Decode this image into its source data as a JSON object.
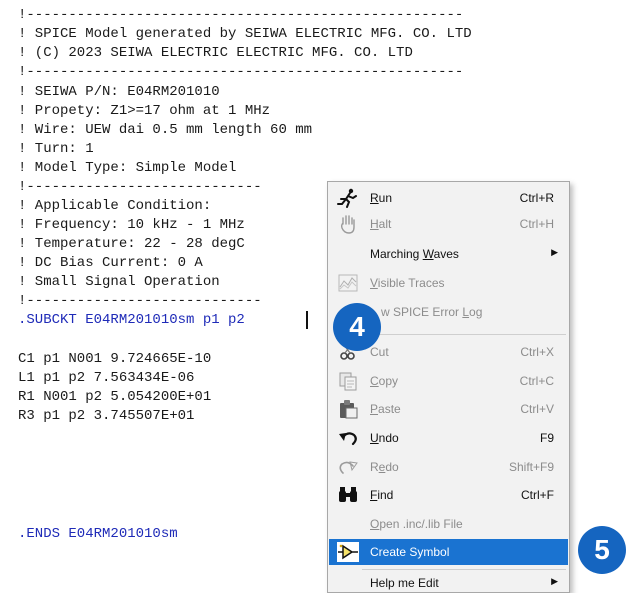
{
  "editor": {
    "lines": [
      "!----------------------------------------------------",
      "! SPICE Model generated by SEIWA ELECTRIC MFG. CO. LTD",
      "! (C) 2023 SEIWA ELECTRIC ELECTRIC MFG. CO. LTD",
      "!----------------------------------------------------",
      "! SEIWA P/N: E04RM201010",
      "! Propety: Z1>=17 ohm at 1 MHz",
      "! Wire: UEW dai 0.5 mm length 60 mm",
      "! Turn: 1",
      "! Model Type: Simple Model",
      "!----------------------------",
      "! Applicable Condition:",
      "! Frequency: 10 kHz - 1 MHz",
      "! Temperature: 22 - 28 degC",
      "! DC Bias Current: 0 A",
      "! Small Signal Operation",
      "!----------------------------",
      ".SUBCKT E04RM201010sm p1 p2",
      "",
      "C1 p1 N001 9.724665E-10",
      "L1 p1 p2 7.563434E-06",
      "R1 N001 p2 5.054200E+01",
      "R3 p1 p2 3.745507E+01",
      ".ENDS E04RM201010sm"
    ]
  },
  "menu": {
    "items": [
      {
        "pre": "",
        "u": "R",
        "post": "un",
        "shortcut": "Ctrl+R",
        "icon": "run-icon"
      },
      {
        "pre": "",
        "u": "H",
        "post": "alt",
        "shortcut": "Ctrl+H",
        "icon": "halt-hand-icon"
      },
      {
        "pre": "Marching ",
        "u": "W",
        "post": "aves",
        "shortcut": "",
        "icon": ""
      },
      {
        "pre": "",
        "u": "V",
        "post": "isible Traces",
        "shortcut": "",
        "icon": "visible-traces-icon"
      },
      {
        "pre": "w SPICE Error ",
        "u": "L",
        "post": "og",
        "shortcut": "",
        "icon": ""
      },
      {
        "pre": "",
        "u": "",
        "post": "Cut",
        "shortcut": "Ctrl+X",
        "icon": "cut-icon"
      },
      {
        "pre": "",
        "u": "C",
        "post": "opy",
        "shortcut": "Ctrl+C",
        "icon": "copy-icon"
      },
      {
        "pre": "",
        "u": "P",
        "post": "aste",
        "shortcut": "Ctrl+V",
        "icon": "paste-icon"
      },
      {
        "pre": "",
        "u": "U",
        "post": "ndo",
        "shortcut": "F9",
        "icon": "undo-icon"
      },
      {
        "pre": "R",
        "u": "e",
        "post": "do",
        "shortcut": "Shift+F9",
        "icon": "redo-icon"
      },
      {
        "pre": "",
        "u": "F",
        "post": "ind",
        "shortcut": "Ctrl+F",
        "icon": "find-binoculars-icon"
      },
      {
        "pre": "",
        "u": "O",
        "post": "pen .inc/.lib File",
        "shortcut": "",
        "icon": ""
      },
      {
        "pre": "",
        "u": "",
        "post": "Create Symbol",
        "shortcut": "",
        "icon": "create-symbol-icon"
      },
      {
        "pre": "Help me Edit",
        "u": "",
        "post": "",
        "shortcut": "",
        "icon": ""
      }
    ]
  },
  "badges": {
    "step4": "4",
    "step5": "5"
  },
  "colors": {
    "highlight": "#1a73d1",
    "badge": "#1565c0",
    "code_blue": "#1f2bb8"
  }
}
